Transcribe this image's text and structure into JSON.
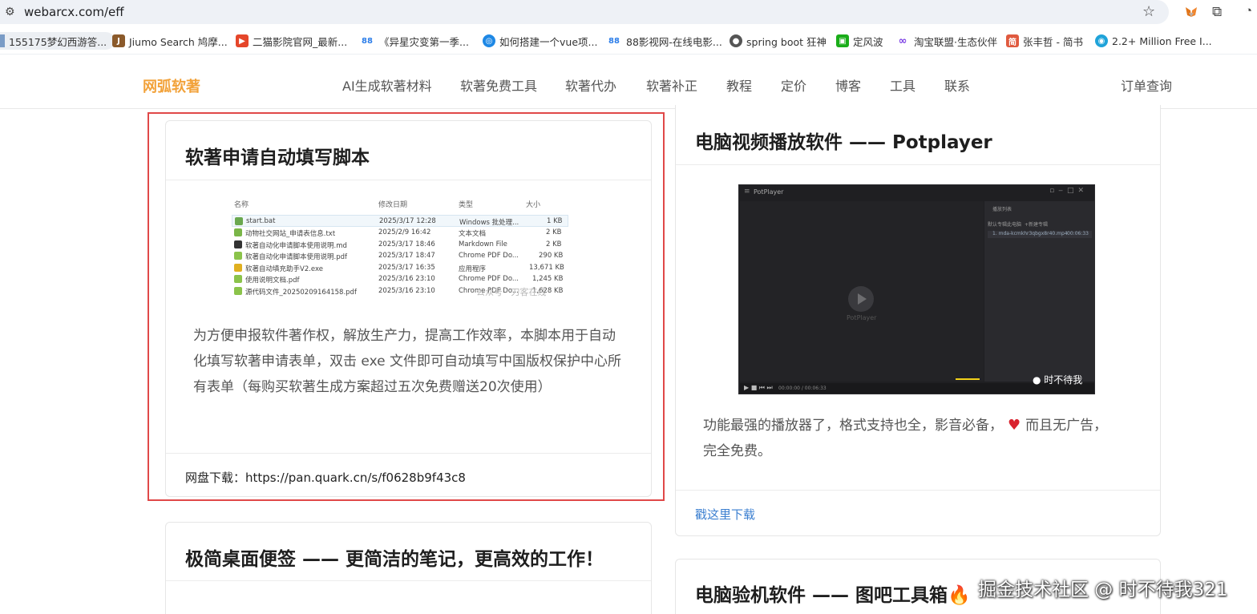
{
  "browser": {
    "url": "webarcx.com/eff",
    "bookmarks": [
      {
        "label": "155175梦幻西游答...",
        "color": "#7a9cc6"
      },
      {
        "label": "Jiumo Search 鸠摩...",
        "color": "#8b5a2b"
      },
      {
        "label": "二猫影院官网_最新...",
        "color": "#e5462a"
      },
      {
        "label": "《异星灾变第一季...",
        "color": "#2b7de9"
      },
      {
        "label": "如何搭建一个vue项...",
        "color": "#1e88e5"
      },
      {
        "label": "88影视网-在线电影...",
        "color": "#2b7de9"
      },
      {
        "label": "spring boot 狂神",
        "color": "#555555"
      },
      {
        "label": "定风波",
        "color": "#1aad19"
      },
      {
        "label": "淘宝联盟·生态伙伴",
        "color": "#7b3fe4"
      },
      {
        "label": "张丰哲 - 简书",
        "color": "#e05a3f"
      },
      {
        "label": "2.2+ Million Free I...",
        "color": "#1fa3d9"
      }
    ],
    "bookmark_badges": [
      "J",
      "88",
      "88"
    ]
  },
  "site": {
    "logo": "网弧软著",
    "nav": [
      "AI生成软著材料",
      "软著免费工具",
      "软著代办",
      "软著补正",
      "教程",
      "定价",
      "博客",
      "工具",
      "联系"
    ],
    "order_query": "订单查询"
  },
  "cards": {
    "script": {
      "title": "软著申请自动填写脚本",
      "description": "为方便申报软件著作权，解放生产力，提高工作效率，本脚本用于自动化填写软著申请表单，双击 exe 文件即可自动填写中国版权保护中心所有表单（每购买软著生成方案超过五次免费赠送20次使用）",
      "link": "网盘下载：https://pan.quark.cn/s/f0628b9f43c8",
      "file_list": {
        "headers": [
          "名称",
          "修改日期",
          "类型",
          "大小"
        ],
        "rows": [
          {
            "name": "start.bat",
            "date": "2025/3/17 12:28",
            "type": "Windows 批处理...",
            "size": "1 KB",
            "icon_color": "#6aa84f"
          },
          {
            "name": "动物社交网站_申请表信息.txt",
            "date": "2025/2/9 16:42",
            "type": "文本文档",
            "size": "2 KB",
            "icon_color": "#7ab648"
          },
          {
            "name": "软著自动化申请脚本使用说明.md",
            "date": "2025/3/17 18:46",
            "type": "Markdown File",
            "size": "2 KB",
            "icon_color": "#333333"
          },
          {
            "name": "软著自动化申请脚本使用说明.pdf",
            "date": "2025/3/17 18:47",
            "type": "Chrome PDF Do...",
            "size": "290 KB",
            "icon_color": "#8bc34a"
          },
          {
            "name": "软著自动填充助手V2.exe",
            "date": "2025/3/17 16:35",
            "type": "应用程序",
            "size": "13,671 KB",
            "icon_color": "#e0b020"
          },
          {
            "name": "使用说明文档.pdf",
            "date": "2025/3/16 23:10",
            "type": "Chrome PDF Do...",
            "size": "1,245 KB",
            "icon_color": "#8bc34a"
          },
          {
            "name": "源代码文件_20250209164158.pdf",
            "date": "2025/3/16 23:10",
            "type": "Chrome PDF Do...",
            "size": "1,628 KB",
            "icon_color": "#8bc34a"
          }
        ],
        "watermark": "公众号 · 刀客在线"
      }
    },
    "potplayer": {
      "title": "电脑视频播放软件 —— Potplayer",
      "description_a": "功能最强的播放器了，格式支持也全，影音必备，",
      "description_b": "而且无广告，完全免费。",
      "link": "戳这里下载",
      "player": {
        "window_title": "PotPlayer",
        "logo_text": "PotPlayer",
        "playlist_tab": "播放列表",
        "side_tabs": [
          "默认专辑",
          "此电脑",
          "+新建专辑"
        ],
        "item": "1. mda-kcmkhr3qbgx8r40.mp4",
        "item_time": "00:06:33",
        "time": "00:00:00 / 00:06:33",
        "watermark": "时不待我"
      }
    },
    "notes": {
      "title": "极简桌面便签 —— 更简洁的笔记，更高效的工作！"
    },
    "toolbox": {
      "title": "电脑验机软件 —— 图吧工具箱🔥"
    }
  },
  "watermark": "掘金技术社区 @ 时不待我321"
}
